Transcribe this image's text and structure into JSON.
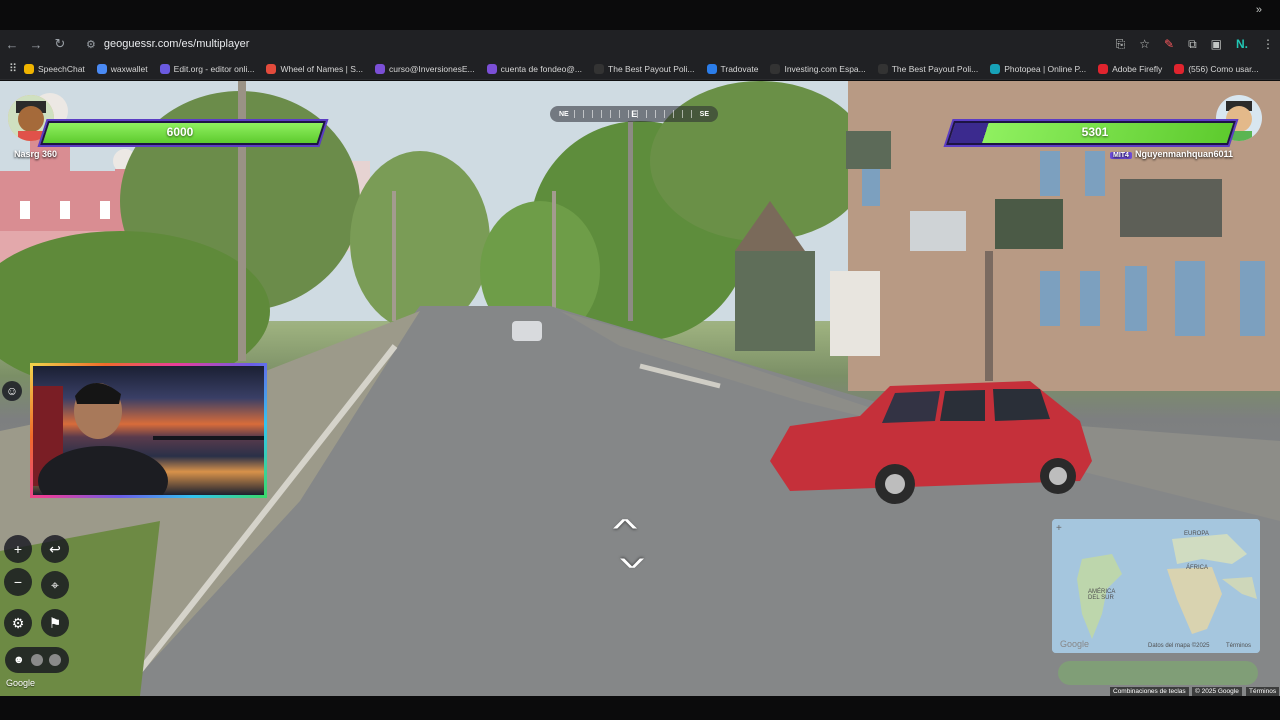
{
  "browser": {
    "url": "geoguessr.com/es/multiplayer",
    "bookmarks": [
      {
        "label": "SpeechChat",
        "color": "#f0b400"
      },
      {
        "label": "waxwallet",
        "color": "#4a8af4"
      },
      {
        "label": "Edit.org - editor onli...",
        "color": "#6a5ae0"
      },
      {
        "label": "Wheel of Names | S...",
        "color": "#e34b3c"
      },
      {
        "label": "curso@InversionesE...",
        "color": "#7b4fd6"
      },
      {
        "label": "cuenta de fondeo@...",
        "color": "#7b4fd6"
      },
      {
        "label": "The Best Payout Poli...",
        "color": "#333333"
      },
      {
        "label": "Tradovate",
        "color": "#2b7de9"
      },
      {
        "label": "Investing.com Espa...",
        "color": "#333333"
      },
      {
        "label": "The Best Payout Poli...",
        "color": "#333333"
      },
      {
        "label": "Photopea | Online P...",
        "color": "#17a2b8"
      },
      {
        "label": "Adobe Firefly",
        "color": "#e0242e"
      },
      {
        "label": "(556) Como usar...",
        "color": "#e0242e"
      }
    ]
  },
  "game": {
    "player_left": {
      "score": "6000",
      "name": "Nasrg 360"
    },
    "player_right": {
      "score": "5301",
      "level": "MIT4",
      "name": "Nguyenmanhquan6011"
    },
    "compass": {
      "ne": "NE",
      "e": "E",
      "se": "SE"
    },
    "minimap": {
      "labels": {
        "europa": "EUROPA",
        "africa": "ÁFRICA",
        "america": "AMÉRICA DEL SUR"
      },
      "google": "Google",
      "map_data": "Datos del mapa ©2025",
      "terms": "Términos"
    },
    "google_logo": "Google",
    "footer": {
      "shortcuts": "Combinaciones de teclas",
      "copyright": "© 2025 Google",
      "terms": "Términos"
    }
  }
}
